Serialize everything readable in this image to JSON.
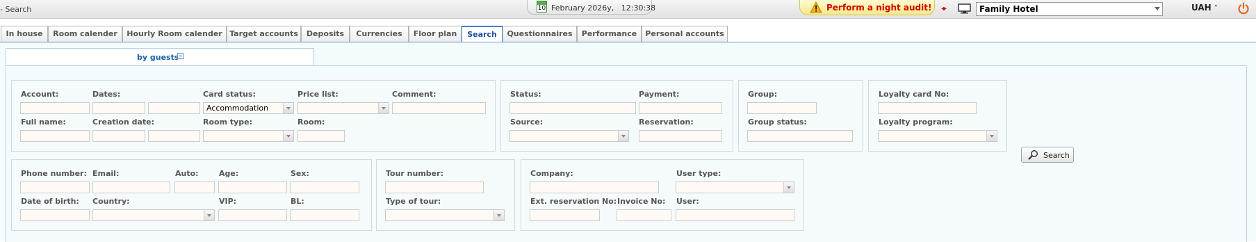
{
  "topbar": {
    "breadcrumb": "- Search",
    "date": "February 2026y,",
    "time": "12:30:38",
    "calendar_day": "10",
    "audit_warning": "Perform a night audit!",
    "hotel": "Family Hotel",
    "currency": "UAH"
  },
  "tabs": [
    {
      "label": "In house"
    },
    {
      "label": "Room calender"
    },
    {
      "label": "Hourly Room calender"
    },
    {
      "label": "Target accounts"
    },
    {
      "label": "Deposits"
    },
    {
      "label": "Currencies"
    },
    {
      "label": "Floor plan"
    },
    {
      "label": "Search",
      "active": true
    },
    {
      "label": "Questionnaires"
    },
    {
      "label": "Performance"
    },
    {
      "label": "Personal accounts"
    }
  ],
  "subtab": {
    "label": "by guests"
  },
  "form": {
    "account": "Account:",
    "dates": "Dates:",
    "card_status": "Card status:",
    "card_status_value": "Accommodation",
    "price_list": "Price list:",
    "comment": "Comment:",
    "full_name": "Full name:",
    "creation_date": "Creation date:",
    "room_type": "Room type:",
    "room": "Room:",
    "status": "Status:",
    "payment": "Payment:",
    "source": "Source:",
    "reservation": "Reservation:",
    "group": "Group:",
    "group_status": "Group status:",
    "loyalty_card_no": "Loyalty card No:",
    "loyalty_program": "Loyalty program:",
    "phone_number": "Phone number:",
    "email": "Email:",
    "auto": "Auto:",
    "age": "Age:",
    "sex": "Sex:",
    "date_of_birth": "Date of birth:",
    "country": "Country:",
    "vip": "VIP:",
    "bl": "BL:",
    "tour_number": "Tour number:",
    "type_of_tour": "Type of tour:",
    "company": "Company:",
    "user_type": "User type:",
    "ext_reservation_no": "Ext. reservation No:",
    "invoice_no": "Invoice No:",
    "user": "User:"
  },
  "search_button": "Search",
  "colors": {
    "accent": "#3f7fcf",
    "warning_text": "#d20000",
    "pane_bg": "#f5fbfc"
  },
  "icons": [
    "calendar-icon",
    "warning-icon",
    "arrows-icon",
    "monitor-icon",
    "power-icon",
    "collapse-icon",
    "magnifier-icon"
  ]
}
